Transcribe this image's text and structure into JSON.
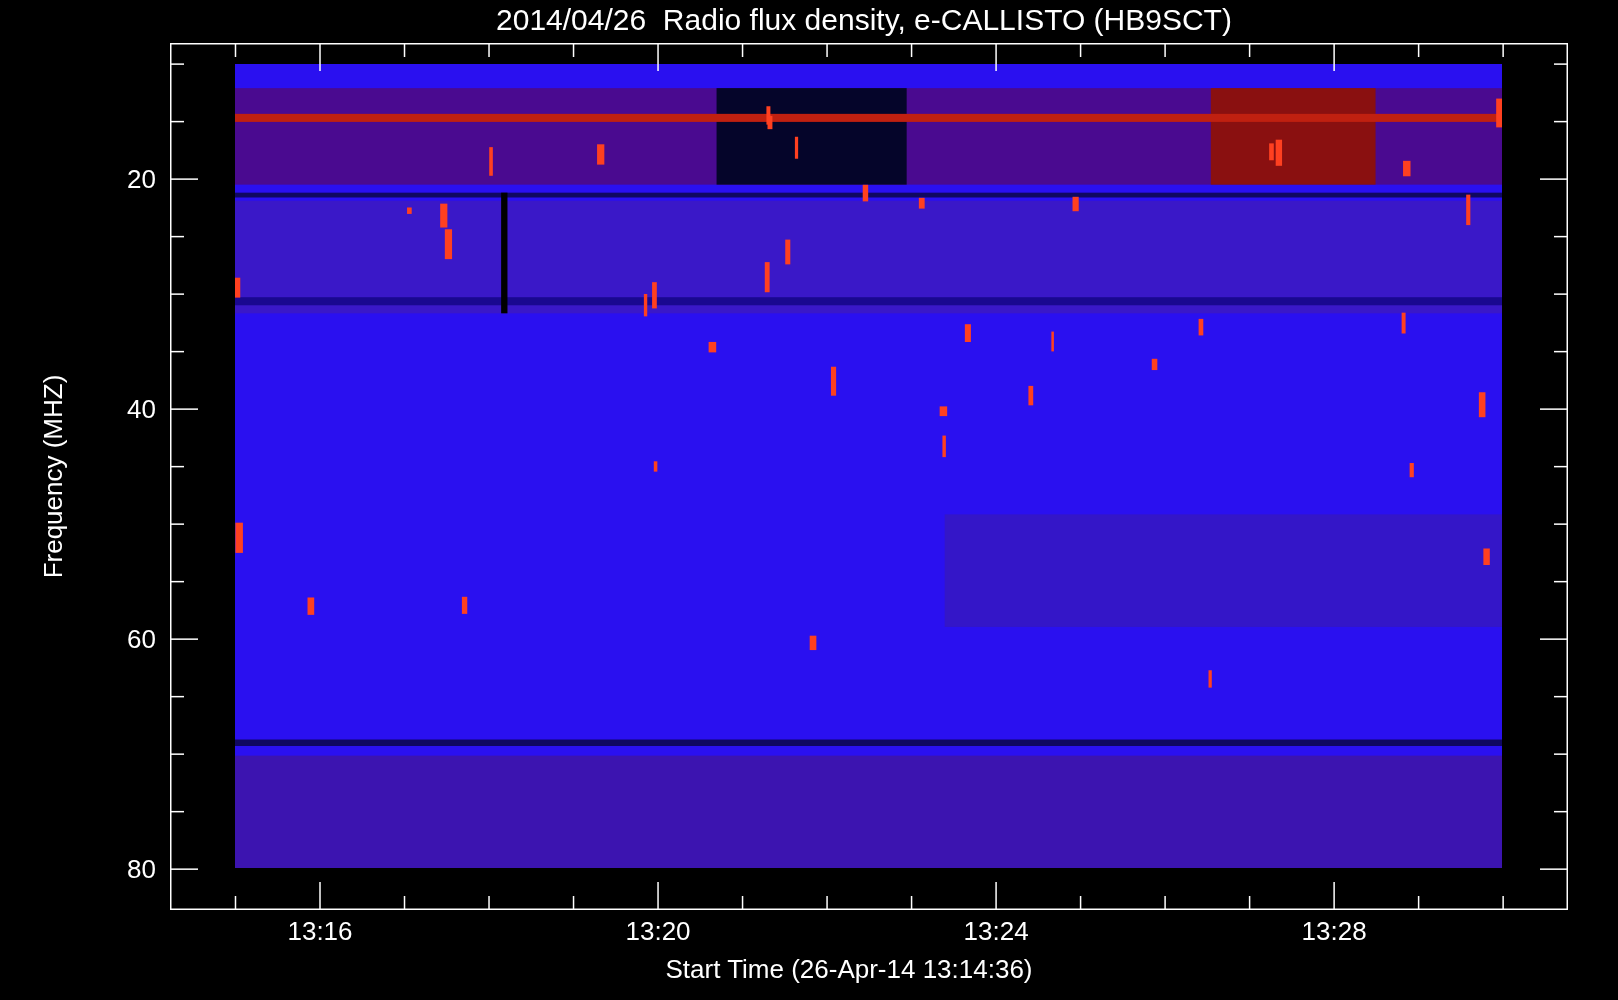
{
  "title": "2014/04/26  Radio flux density, e-CALLISTO (HB9SCT)",
  "plot": {
    "ylabel": "Frequency (MHZ)",
    "xlabel": "Start Time (26-Apr-14 13:14:36)",
    "yticks": [
      {
        "label": "20"
      },
      {
        "label": "40"
      },
      {
        "label": "60"
      },
      {
        "label": "80"
      }
    ],
    "xticks": [
      {
        "label": "13:16"
      },
      {
        "label": "13:20"
      },
      {
        "label": "13:24"
      },
      {
        "label": "13:28"
      }
    ]
  }
}
